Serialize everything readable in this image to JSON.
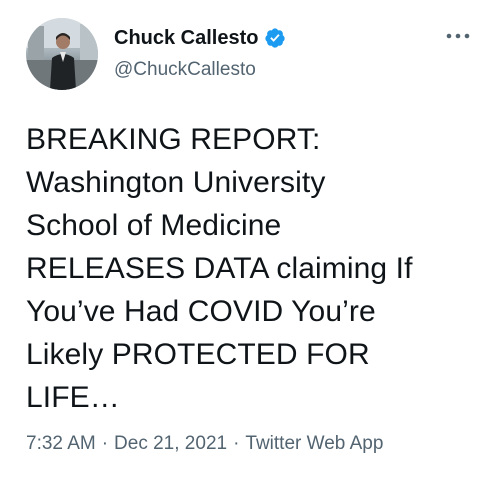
{
  "tweet": {
    "author": {
      "display_name": "Chuck Callesto",
      "handle": "@ChuckCallesto",
      "verified": true,
      "verified_icon": "verified-badge-icon",
      "verified_color": "#1d9bf0"
    },
    "text": "BREAKING REPORT:\nWashington University\nSchool of Medicine\nRELEASES DATA claiming If\nYou’ve Had COVID You’re\nLikely PROTECTED FOR\nLIFE…",
    "time": "7:32 AM",
    "date": "Dec 21, 2021",
    "separator": "·",
    "source": "Twitter Web App",
    "more_icon": "more-options-icon"
  }
}
